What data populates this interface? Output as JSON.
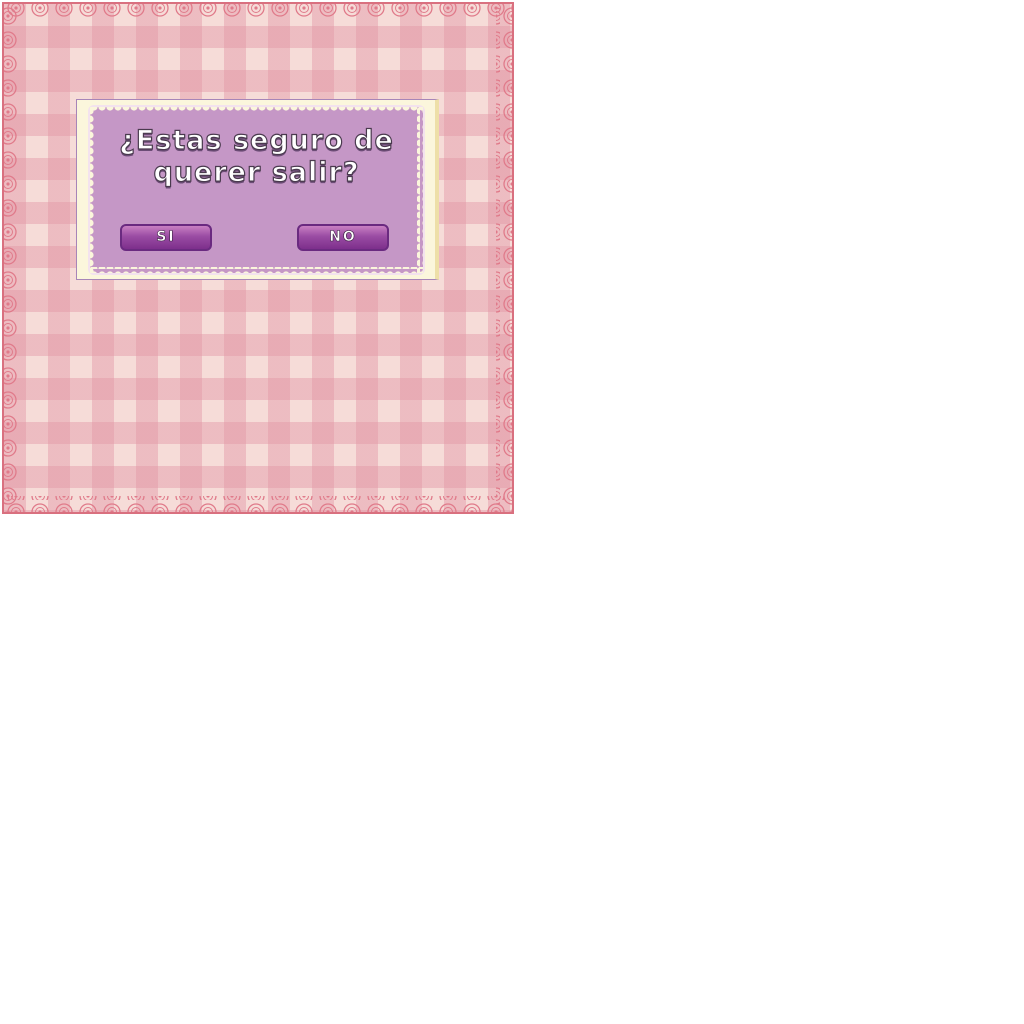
{
  "dialog": {
    "question_line1": "¿Estas seguro de",
    "question_line2": "querer salir?",
    "yes_label": "SI",
    "no_label": "NO"
  },
  "colors": {
    "frame_border": "#d9707f",
    "gingham_light": "#f6dcd8",
    "gingham_dark": "#e296a5",
    "panel_cream": "#fbf6dc",
    "panel_purple": "#c597c6",
    "button_purple": "#9a4ca3"
  },
  "icons": {
    "frame_decoration": "lace-border-icon"
  }
}
